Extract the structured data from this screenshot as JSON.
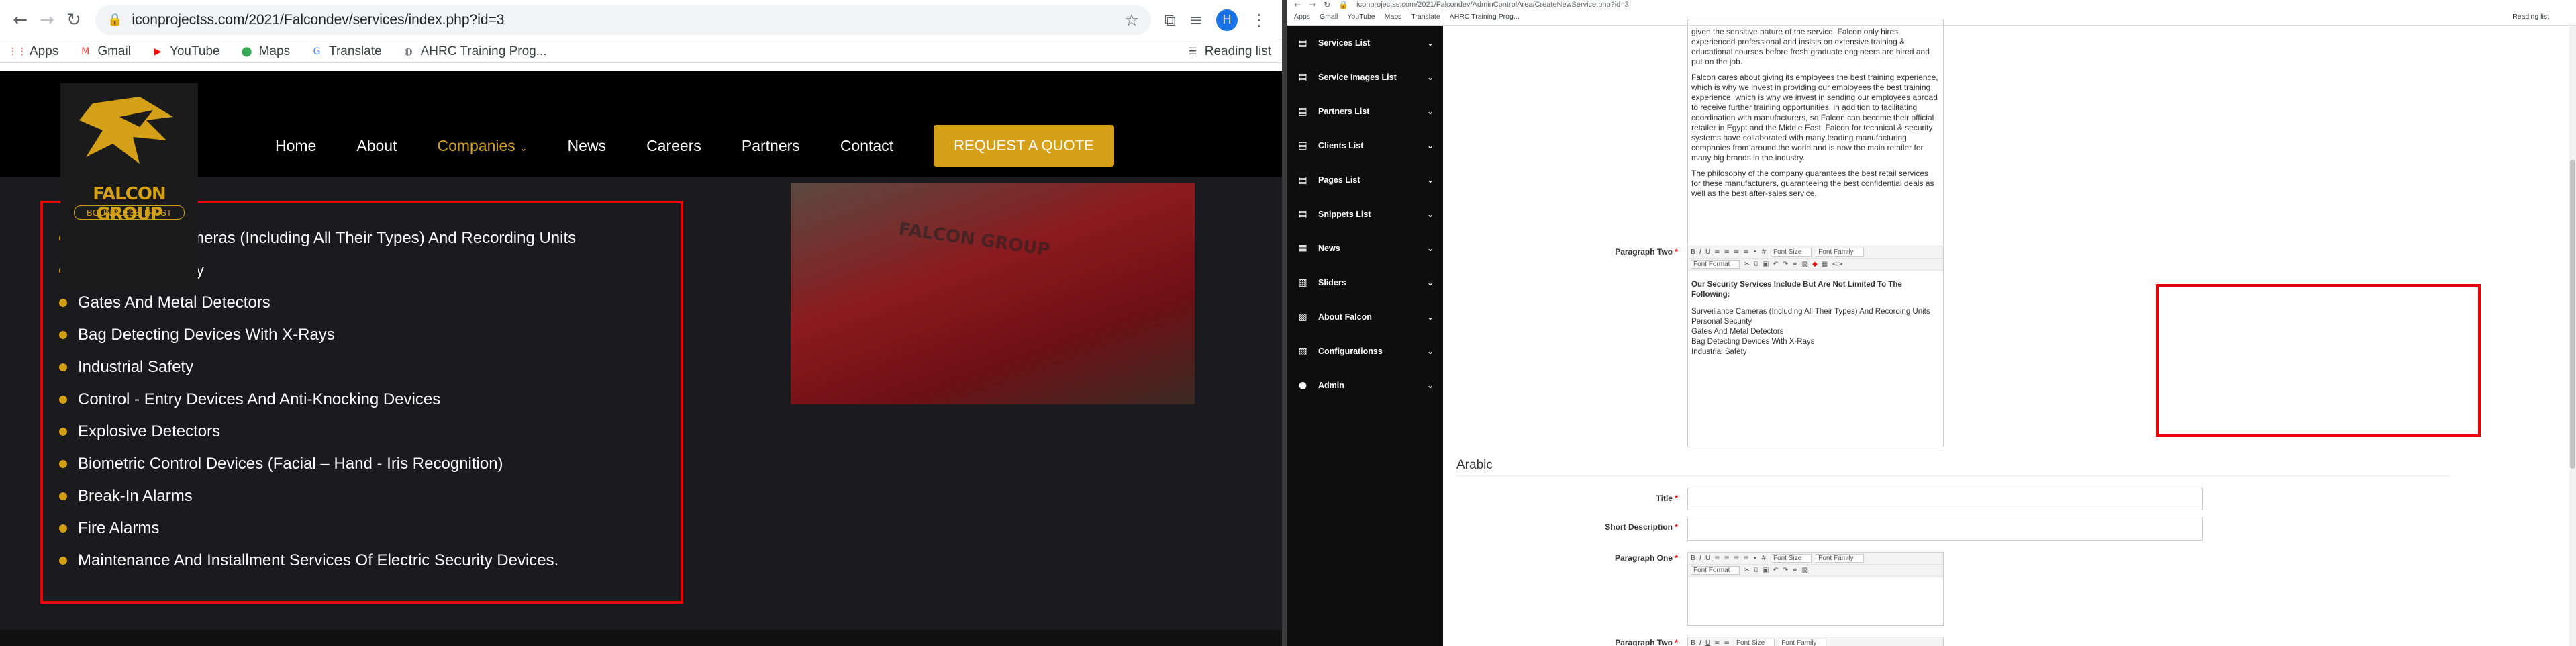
{
  "left_browser": {
    "url": "iconprojectss.com/2021/Falcondev/services/index.php?id=3",
    "avatar_letter": "H",
    "bookmarks": [
      {
        "label": "Apps",
        "icon": "apps-grid-icon",
        "color": "#ea4335"
      },
      {
        "label": "Gmail",
        "icon": "gmail-icon",
        "color": "#ea4335"
      },
      {
        "label": "YouTube",
        "icon": "youtube-icon",
        "color": "#ff0000"
      },
      {
        "label": "Maps",
        "icon": "maps-pin-icon",
        "color": "#34a853"
      },
      {
        "label": "Translate",
        "icon": "translate-icon",
        "color": "#4285f4"
      },
      {
        "label": "AHRC Training Prog...",
        "icon": "globe-icon",
        "color": "#5f6368"
      }
    ],
    "reading_list": "Reading list"
  },
  "site": {
    "logo_title": "FALCON GROUP",
    "logo_sub": "BOUNDLESS TRUST",
    "brand_color": "#d4a017",
    "menu": [
      "Home",
      "About",
      "Companies",
      "News",
      "Careers",
      "Partners",
      "Contact"
    ],
    "menu_active": "Companies",
    "quote_button": "REQUEST A QUOTE",
    "photo_text": "FALCON GROUP",
    "services": [
      "Surveillance Cameras (Including All Their Types) And Recording Units",
      "Personal Security",
      "Gates And Metal Detectors",
      "Bag Detecting Devices With X-Rays",
      "Industrial Safety",
      "Control - Entry Devices And Anti-Knocking Devices",
      "Explosive Detectors",
      "Biometric Control Devices (Facial – Hand - Iris Recognition)",
      "Break-In Alarms",
      "Fire Alarms",
      "Maintenance And Installment Services Of Electric Security Devices."
    ]
  },
  "right_browser": {
    "url": "iconprojectss.com/2021/Falcondev/AdminControlArea/CreateNewService.php?id=3",
    "bookmarks": [
      "Apps",
      "Gmail",
      "YouTube",
      "Maps",
      "Translate",
      "AHRC Training Prog..."
    ],
    "reading_list": "Reading list"
  },
  "admin": {
    "sidebar": [
      {
        "label": "Services List",
        "icon": "file-icon"
      },
      {
        "label": "Service Images List",
        "icon": "file-icon"
      },
      {
        "label": "Partners List",
        "icon": "file-icon"
      },
      {
        "label": "Clients List",
        "icon": "file-icon"
      },
      {
        "label": "Pages List",
        "icon": "file-icon"
      },
      {
        "label": "Snippets List",
        "icon": "file-icon"
      },
      {
        "label": "News",
        "icon": "newspaper-icon"
      },
      {
        "label": "Sliders",
        "icon": "image-icon"
      },
      {
        "label": "About Falcon",
        "icon": "image-icon"
      },
      {
        "label": "Configurationss",
        "icon": "image-icon"
      },
      {
        "label": "Admin",
        "icon": "user-icon"
      }
    ],
    "paragraph_one_text": [
      "given the sensitive nature of the service, Falcon only hires experienced professional and insists on extensive training & educational courses before fresh graduate engineers are hired and put on the job.",
      "Falcon cares about giving its employees the best training experience, which is why we invest in providing our employees the best training experience, which is why we invest in sending our employees abroad to receive further training opportunities, in addition to facilitating coordination with manufacturers, so Falcon can become their official retailer in Egypt and the Middle East. Falcon for technical & security systems have collaborated with many leading manufacturing companies from around the world and is now the main retailer for many big brands in the industry.",
      "The philosophy of the company guarantees the best retail services for these manufacturers, guaranteeing the best confidential deals as well as the best after-sales service."
    ],
    "paragraph_two_label": "Paragraph Two",
    "toolbar": {
      "font_size": "Font Size",
      "font_family": "Font Family",
      "font_format": "Font Format"
    },
    "paragraph_two_heading": "Our Security Services Include But Are Not Limited To The Following:",
    "paragraph_two_lines": [
      "Surveillance Cameras (Including All Their Types) And Recording Units",
      "Personal Security",
      "Gates And Metal Detectors",
      "Bag Detecting Devices With X-Rays",
      "Industrial Safety"
    ],
    "arabic_section": "Arabic",
    "title_label": "Title",
    "short_desc_label": "Short Description",
    "paragraph_one_label": "Paragraph One",
    "required_mark": "*"
  }
}
